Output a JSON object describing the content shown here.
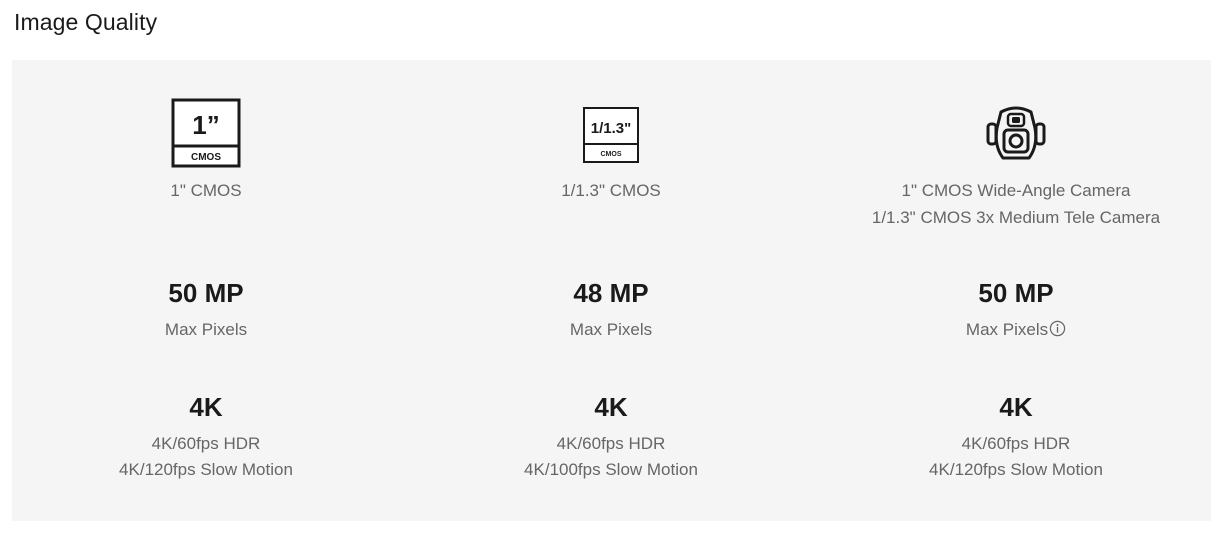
{
  "section": {
    "title": "Image Quality"
  },
  "columns": [
    {
      "icon": "sensor-1inch-icon",
      "icon_text": {
        "main": "1”",
        "sub": "CMOS"
      },
      "sensor_lines": [
        "1\" CMOS"
      ],
      "max_pixels_value": "50 MP",
      "max_pixels_label": "Max Pixels",
      "video_value": "4K",
      "video_lines": [
        "4K/60fps HDR",
        "4K/120fps Slow Motion"
      ]
    },
    {
      "icon": "sensor-1-1.3inch-icon",
      "icon_text": {
        "main": "1/1.3\"",
        "sub": "CMOS"
      },
      "sensor_lines": [
        "1/1.3\" CMOS"
      ],
      "max_pixels_value": "48 MP",
      "max_pixels_label": "Max Pixels",
      "video_value": "4K",
      "video_lines": [
        "4K/60fps HDR",
        "4K/100fps Slow Motion"
      ]
    },
    {
      "icon": "dual-camera-icon",
      "sensor_lines": [
        "1\" CMOS Wide-Angle Camera",
        "1/1.3\" CMOS 3x Medium Tele Camera"
      ],
      "max_pixels_value": "50 MP",
      "max_pixels_label": "Max Pixels",
      "info_icon": "info-circle-icon",
      "video_value": "4K",
      "video_lines": [
        "4K/60fps HDR",
        "4K/120fps Slow Motion"
      ]
    }
  ],
  "colors": {
    "panel_bg": "#f5f5f5",
    "heading_text": "#1a1a1a",
    "secondary_text": "#666666"
  }
}
